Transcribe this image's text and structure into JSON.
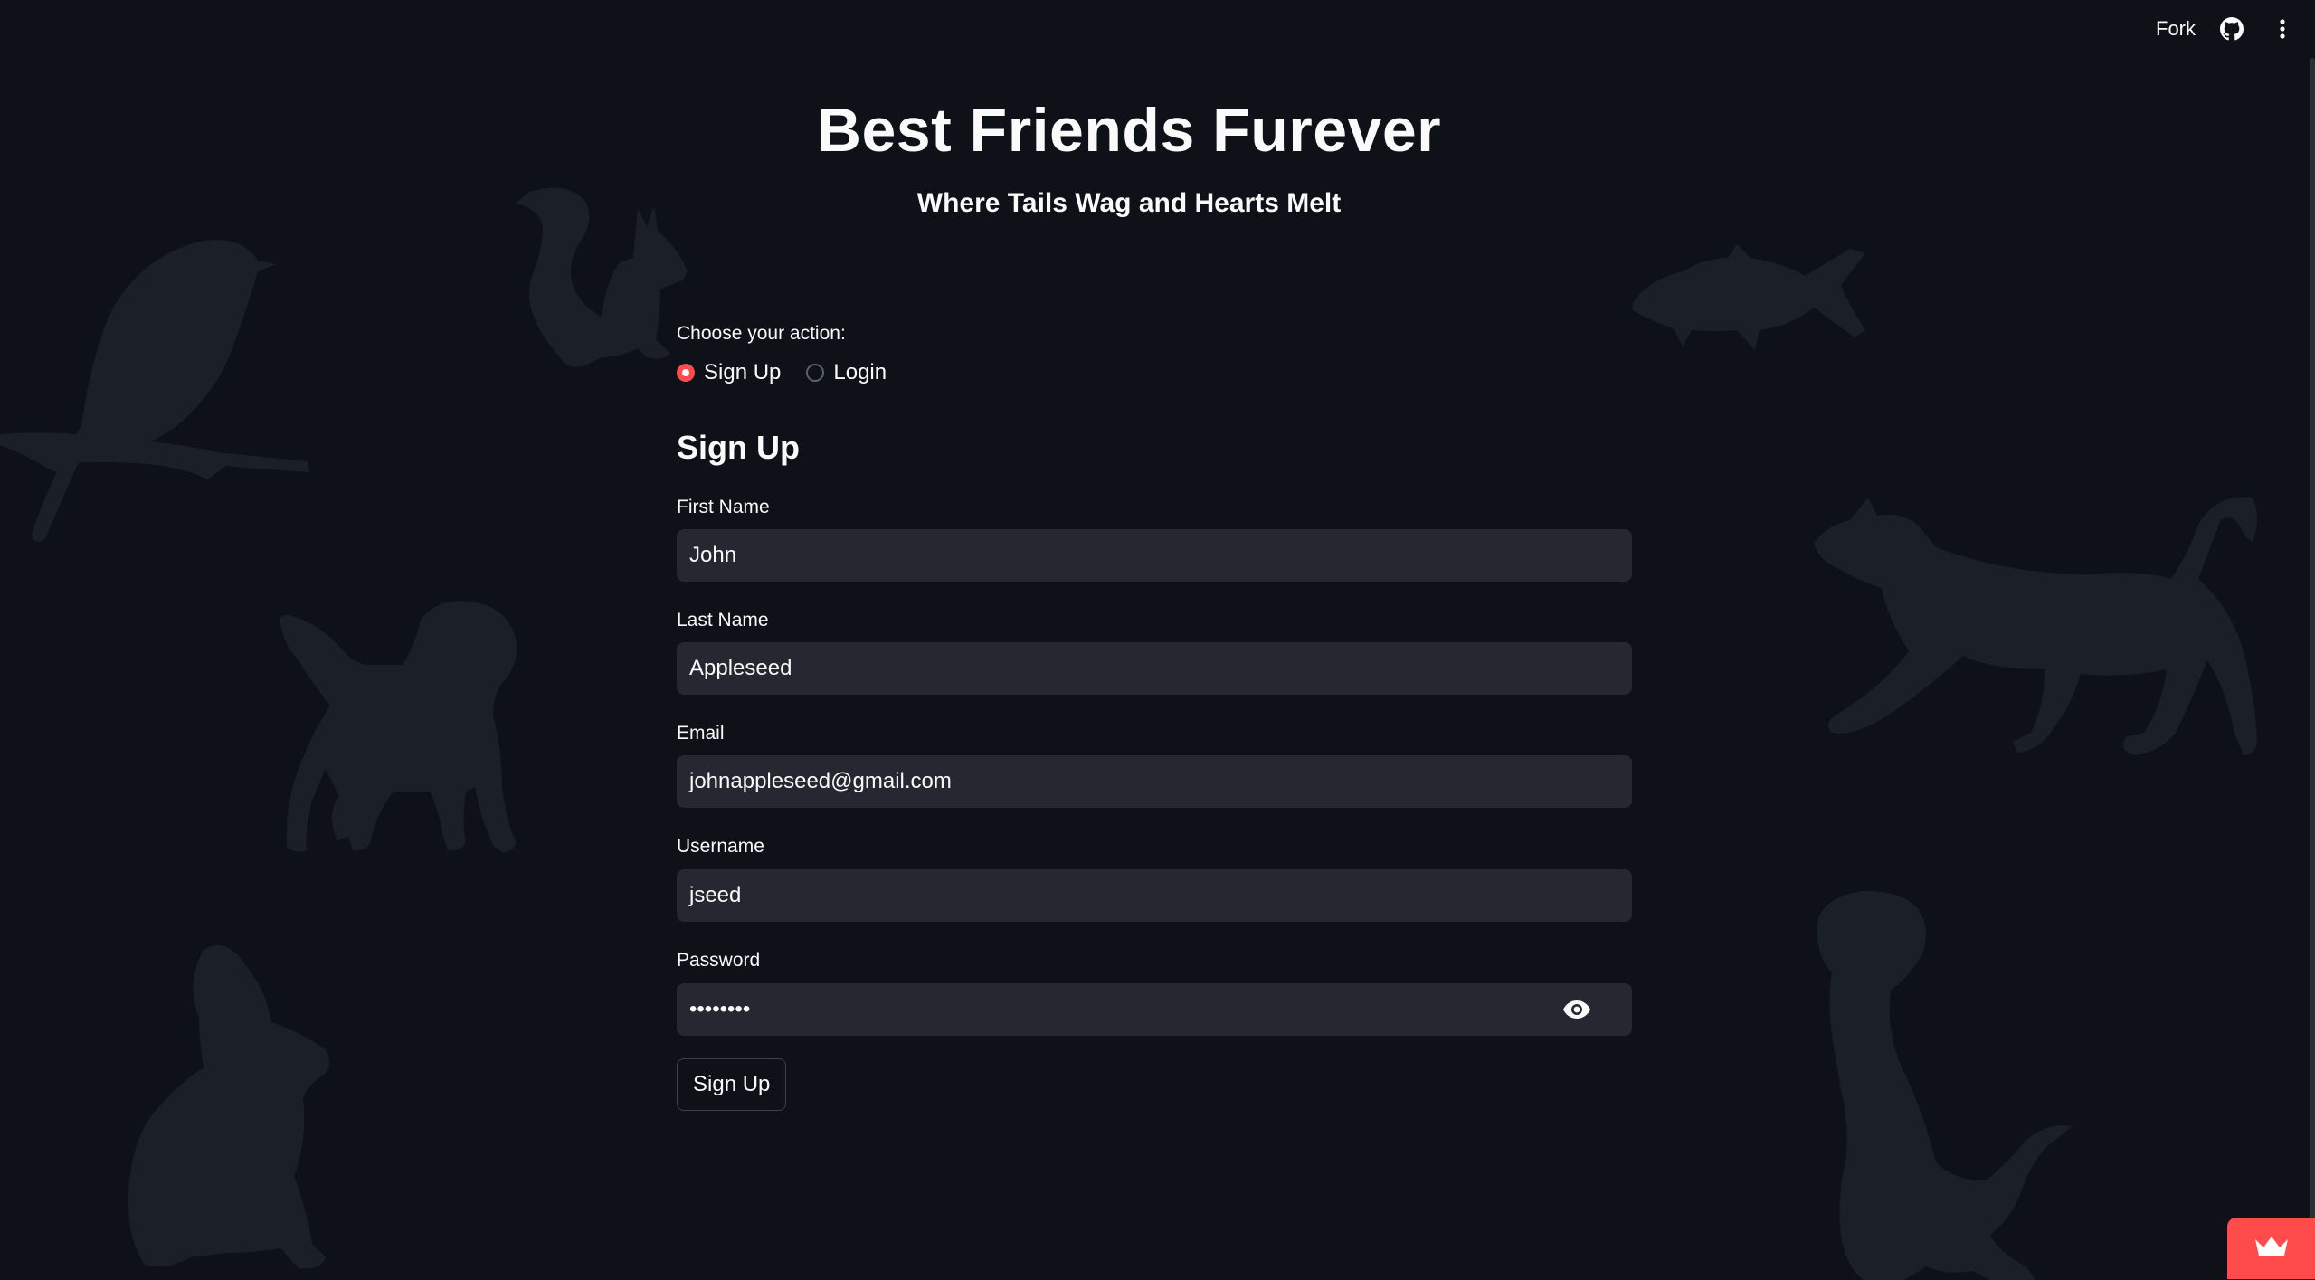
{
  "toolbar": {
    "fork_label": "Fork",
    "github_icon": "github-icon",
    "menu_icon": "more-vertical-icon"
  },
  "header": {
    "title": "Best Friends Furever",
    "subtitle": "Where Tails Wag and Hearts Melt"
  },
  "action": {
    "label": "Choose your action:",
    "options": [
      {
        "label": "Sign Up",
        "selected": true
      },
      {
        "label": "Login",
        "selected": false
      }
    ]
  },
  "form": {
    "heading": "Sign Up",
    "first_name": {
      "label": "First Name",
      "value": "John"
    },
    "last_name": {
      "label": "Last Name",
      "value": "Appleseed"
    },
    "email": {
      "label": "Email",
      "value": "johnappleseed@gmail.com"
    },
    "username": {
      "label": "Username",
      "value": "jseed"
    },
    "password": {
      "label": "Password",
      "value": "••••••••",
      "toggle_icon": "eye-icon"
    },
    "submit_label": "Sign Up"
  },
  "colors": {
    "background": "#0e1117",
    "input_bg": "#262730",
    "accent": "#ff4b4b",
    "silhouette": "#1a1f28"
  },
  "badge": {
    "icon": "crown-icon"
  }
}
